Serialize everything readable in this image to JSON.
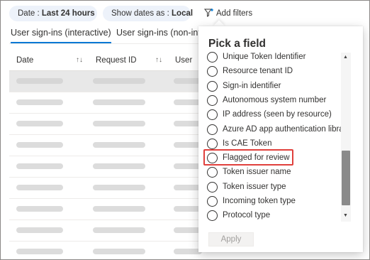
{
  "filters": {
    "date_prefix": "Date : ",
    "date_value": "Last 24 hours",
    "show_prefix": "Show dates as : ",
    "show_value": "Local",
    "add_filters": "Add filters",
    "add_filters_icon": "add-filter-icon"
  },
  "tabs": [
    {
      "label": "User sign-ins (interactive)",
      "active": true
    },
    {
      "label": "User sign-ins (non-inte",
      "active": false
    }
  ],
  "table": {
    "columns": [
      "Date",
      "Request ID",
      "User"
    ],
    "rows": [
      {
        "selected": true
      },
      {
        "selected": false
      },
      {
        "selected": false
      },
      {
        "selected": false
      },
      {
        "selected": false
      },
      {
        "selected": false
      },
      {
        "selected": false
      },
      {
        "selected": false
      },
      {
        "selected": false
      }
    ]
  },
  "picker": {
    "title": "Pick a field",
    "options": [
      "Unique Token Identifier",
      "Resource tenant ID",
      "Sign-in identifier",
      "Autonomous system number",
      "IP address (seen by resource)",
      "Azure AD app authentication library",
      "Is CAE Token",
      "Flagged for review",
      "Token issuer name",
      "Token issuer type",
      "Incoming token type",
      "Protocol type"
    ],
    "highlighted_option": "Flagged for review",
    "apply_label": "Apply",
    "highlight_color": "#e0403c"
  }
}
